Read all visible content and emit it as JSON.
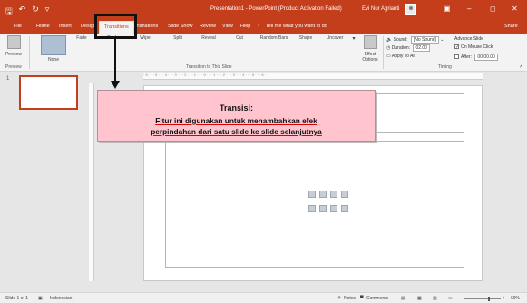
{
  "window": {
    "title": "Presentation1  -  PowerPoint (Product Activation Failed)",
    "user_name": "Evi Nur Agrianti"
  },
  "qat": {
    "save": "🖫",
    "undo": "↶",
    "redo": "↻",
    "customize": "▿"
  },
  "tabs": [
    "File",
    "Home",
    "Insert",
    "Design",
    "Transitions",
    "Animations",
    "Slide Show",
    "Review",
    "View",
    "Help"
  ],
  "active_tab": "Transitions",
  "tell_me": "Tell me what you want to do",
  "share": "Share",
  "ribbon": {
    "preview_label": "Preview",
    "preview_group": "Preview",
    "transitions": [
      "None",
      "Fade",
      "Push",
      "Wipe",
      "Split",
      "Reveal",
      "Cut",
      "Random Bars",
      "Shape",
      "Uncover"
    ],
    "effect_options": "Effect Options",
    "group_label": "Transition to This Slide",
    "timing": {
      "sound_label": "Sound:",
      "sound_value": "[No Sound]",
      "duration_label": "Duration:",
      "duration_value": "02.00",
      "apply_all": "Apply To All",
      "advance_label": "Advance Slide",
      "on_mouse_click": "On Mouse Click",
      "after_label": "After:",
      "after_value": "00:00.00",
      "group": "Timing"
    }
  },
  "slides_pane": {
    "slide_number": "1"
  },
  "ruler": {
    "ticks": "· 6 · · · 5 · · · 4 · · · 3 · · · 2 · · · 1 · · · 0 · · · 1 · · · 2 · · · 3 · · · 4 · · · 5 · · · 6 ·"
  },
  "callout": {
    "title": "Transisi:",
    "line1": "Fitur ini digunakan untuk menambahkan efek",
    "line2": "perpindahan dari satu slide ke slide selanjutnya"
  },
  "status": {
    "slide_info": "Slide 1 of 1",
    "language": "Indonesian",
    "notes": "Notes",
    "comments": "Comments",
    "zoom": "69%"
  },
  "colors": {
    "brand": "#c43e1c",
    "callout_fill": "#ffc4cd"
  }
}
